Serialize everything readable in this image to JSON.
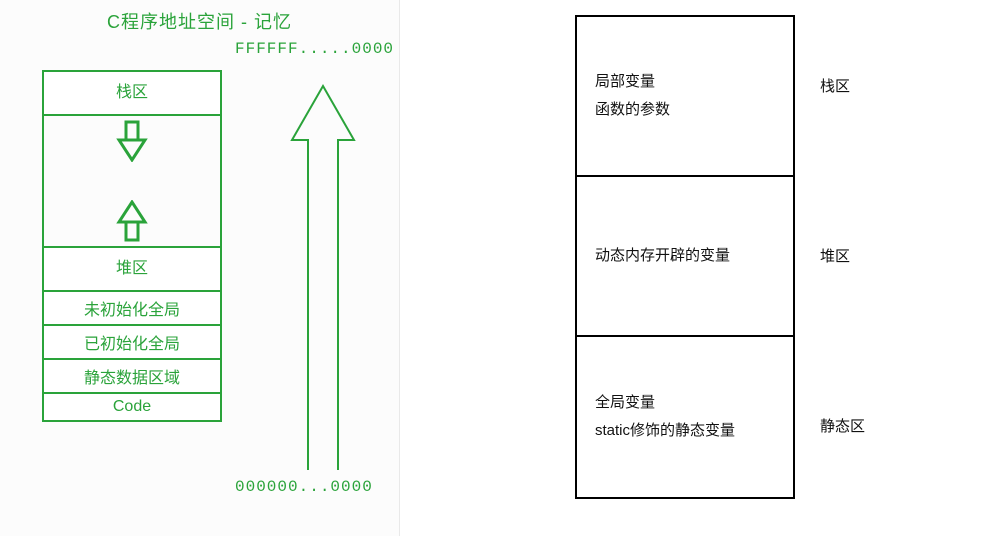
{
  "left": {
    "title": "C程序地址空间 - 记忆",
    "addr_high": "FFFFFF.....0000",
    "addr_low": "000000...0000",
    "segments": {
      "stack": "栈区",
      "heap": "堆区",
      "bss": "未初始化全局",
      "data": "已初始化全局",
      "static_area": "静态数据区域",
      "code": "Code"
    }
  },
  "right": {
    "rows": [
      {
        "lines": [
          "局部变量",
          "函数的参数"
        ],
        "label": "栈区"
      },
      {
        "lines": [
          "动态内存开辟的变量"
        ],
        "label": "堆区"
      },
      {
        "lines": [
          "全局变量",
          "static修饰的静态变量"
        ],
        "label": "静态区"
      }
    ]
  }
}
